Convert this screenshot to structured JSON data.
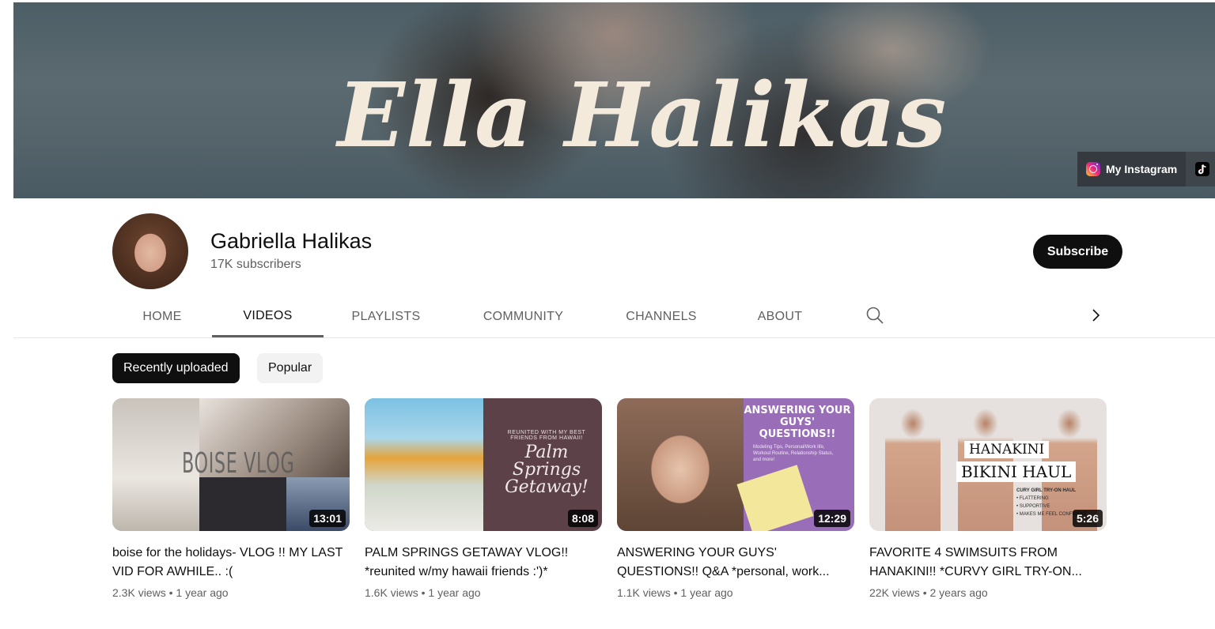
{
  "banner": {
    "title": "Ella Halikas",
    "links": [
      {
        "label": "My Instagram",
        "icon": "instagram-icon"
      },
      {
        "label": "",
        "icon": "tiktok-icon"
      }
    ]
  },
  "channel": {
    "name": "Gabriella Halikas",
    "subscribers": "17K subscribers",
    "subscribe_label": "Subscribe"
  },
  "tabs": [
    {
      "label": "HOME",
      "active": false
    },
    {
      "label": "VIDEOS",
      "active": true
    },
    {
      "label": "PLAYLISTS",
      "active": false
    },
    {
      "label": "COMMUNITY",
      "active": false
    },
    {
      "label": "CHANNELS",
      "active": false
    },
    {
      "label": "ABOUT",
      "active": false
    }
  ],
  "chips": [
    {
      "label": "Recently uploaded",
      "selected": true
    },
    {
      "label": "Popular",
      "selected": false
    }
  ],
  "videos": [
    {
      "title": "boise for the holidays- VLOG !! MY LAST VID FOR AWHILE.. :(",
      "duration": "13:01",
      "views": "2.3K views",
      "age": "1 year ago",
      "thumb_text": "BOISE VLOG"
    },
    {
      "title": "PALM SPRINGS GETAWAY VLOG!! *reunited w/my hawaii friends :')*",
      "duration": "8:08",
      "views": "1.6K views",
      "age": "1 year ago",
      "thumb_sub": "REUNITED WITH MY BEST FRIENDS FROM HAWAII!",
      "thumb_text": "Palm Springs Getaway!"
    },
    {
      "title": "ANSWERING YOUR GUYS' QUESTIONS!! Q&A *personal, work...",
      "duration": "12:29",
      "views": "1.1K views",
      "age": "1 year ago",
      "thumb_text": "ANSWERING YOUR GUYS' QUESTIONS!!",
      "thumb_sub": "Modeling Tips, Personal/Work life, Workout Routine, Relationship Status, and more!"
    },
    {
      "title": "FAVORITE 4 SWIMSUITS FROM HANAKINI!! *CURVY GIRL TRY-ON...",
      "duration": "5:26",
      "views": "22K views",
      "age": "2 years ago",
      "thumb_line1": "HANAKINI",
      "thumb_line2": "BIKINI HAUL",
      "thumb_list": [
        "CURY GIRL TRY-ON HAUL",
        "• FLATTERING",
        "• SUPPORTIVE",
        "• MAKES ME FEEL CONFIDENT"
      ]
    }
  ],
  "colors": {
    "subscribe_bg": "#0f0f0f",
    "chip_selected_bg": "#0f0f0f",
    "chip_bg": "#f2f2f2",
    "secondary_text": "#606060"
  }
}
